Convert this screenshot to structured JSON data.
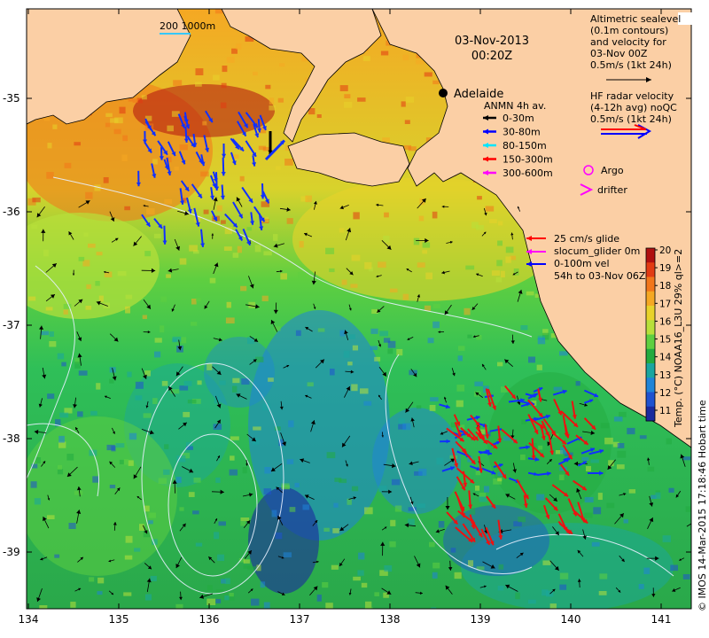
{
  "title": {
    "date": "03-Nov-2013",
    "time": "00:20Z"
  },
  "city": {
    "name": "Adelaide"
  },
  "scale_bar": {
    "label": "200  1000m"
  },
  "altimetric_legend": {
    "lines": [
      "Altimetric sealevel",
      "(0.1m contours)",
      "and velocity for",
      "03-Nov 00Z",
      "0.5m/s (1kt 24h)"
    ]
  },
  "hf_radar_legend": {
    "lines": [
      "HF radar velocity",
      "(4-12h avg) noQC",
      "0.5m/s (1kt 24h)"
    ]
  },
  "anmn_legend": {
    "title": "ANMN 4h av.",
    "items": [
      {
        "label": "0-30m",
        "color": "#000000"
      },
      {
        "label": "30-80m",
        "color": "#0000ff"
      },
      {
        "label": "80-150m",
        "color": "#00e5ff"
      },
      {
        "label": "150-300m",
        "color": "#ff0000"
      },
      {
        "label": "300-600m",
        "color": "#ff00ff"
      }
    ]
  },
  "platform_legend": {
    "argo": "Argo",
    "drifter": "drifter"
  },
  "glider_legend": {
    "lines": [
      "25 cm/s glide",
      "slocum_glider 0m",
      "0-100m vel",
      "54h to 03-Nov 06Z"
    ]
  },
  "colorbar": {
    "ticks": [
      "20",
      "19",
      "18",
      "17",
      "16",
      "15",
      "14",
      "13",
      "12",
      "11"
    ],
    "label": "Temp. (°C) NOAA16_L3U 29% ql>=2",
    "colors": [
      "#b01010",
      "#e23b12",
      "#f2761a",
      "#f5a823",
      "#e8d22a",
      "#b8e03a",
      "#5fcf40",
      "#23ab3f",
      "#1aa6a0",
      "#1f84d8",
      "#1f52d0",
      "#1a2a9e"
    ]
  },
  "x_axis": {
    "ticks": [
      "134",
      "135",
      "136",
      "137",
      "138",
      "139",
      "140",
      "141"
    ]
  },
  "y_axis": {
    "ticks": [
      "-35",
      "-36",
      "-37",
      "-38",
      "-39"
    ]
  },
  "credit": "© IMOS 14-Mar-2015 17:18:46 Hobart time",
  "colors": {
    "land": "#fbcfa5",
    "coast": "#000000",
    "contour": "#e8f0ff"
  }
}
